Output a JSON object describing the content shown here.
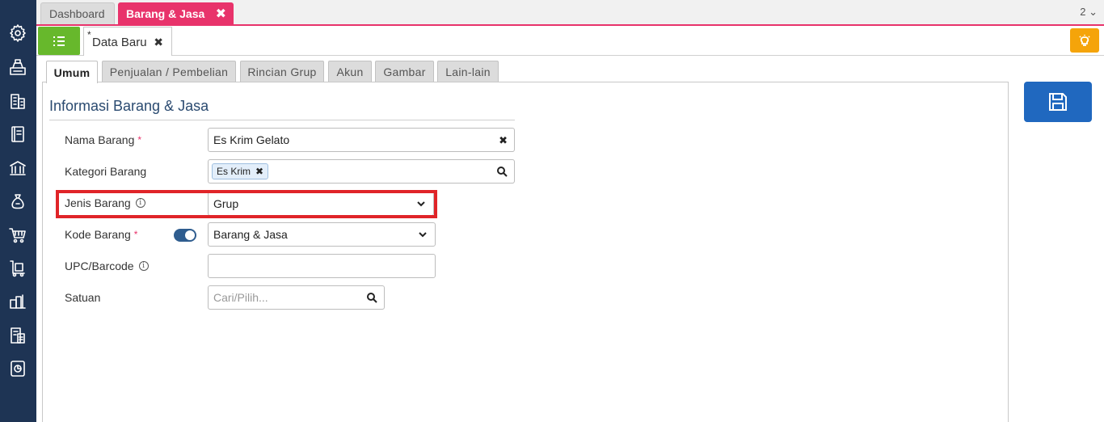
{
  "module_tabs": [
    {
      "label": "Dashboard"
    },
    {
      "label": "Barang & Jasa"
    }
  ],
  "module_tab_count": "2",
  "doc_tab": {
    "modified_marker": "*",
    "label": "Data Baru"
  },
  "form_tabs": [
    {
      "label": "Umum"
    },
    {
      "label": "Penjualan / Pembelian"
    },
    {
      "label": "Rincian Grup"
    },
    {
      "label": "Akun"
    },
    {
      "label": "Gambar"
    },
    {
      "label": "Lain-lain"
    }
  ],
  "section_title": "Informasi Barang & Jasa",
  "fields": {
    "nama_barang": {
      "label": "Nama Barang",
      "required": "*",
      "value": "Es Krim Gelato"
    },
    "kategori_barang": {
      "label": "Kategori Barang",
      "tag": "Es Krim"
    },
    "jenis_barang": {
      "label": "Jenis Barang",
      "value": "Grup"
    },
    "kode_barang": {
      "label": "Kode Barang",
      "required": "*",
      "value": "Barang & Jasa"
    },
    "upc_barcode": {
      "label": "UPC/Barcode",
      "value": ""
    },
    "satuan": {
      "label": "Satuan",
      "placeholder": "Cari/Pilih..."
    }
  },
  "colors": {
    "sidebar": "#1e3454",
    "accent_pink": "#e8336b",
    "list_button": "#67b82c",
    "save_button": "#2068bf",
    "bulb_button": "#f5a40a",
    "highlight": "#e02428"
  }
}
